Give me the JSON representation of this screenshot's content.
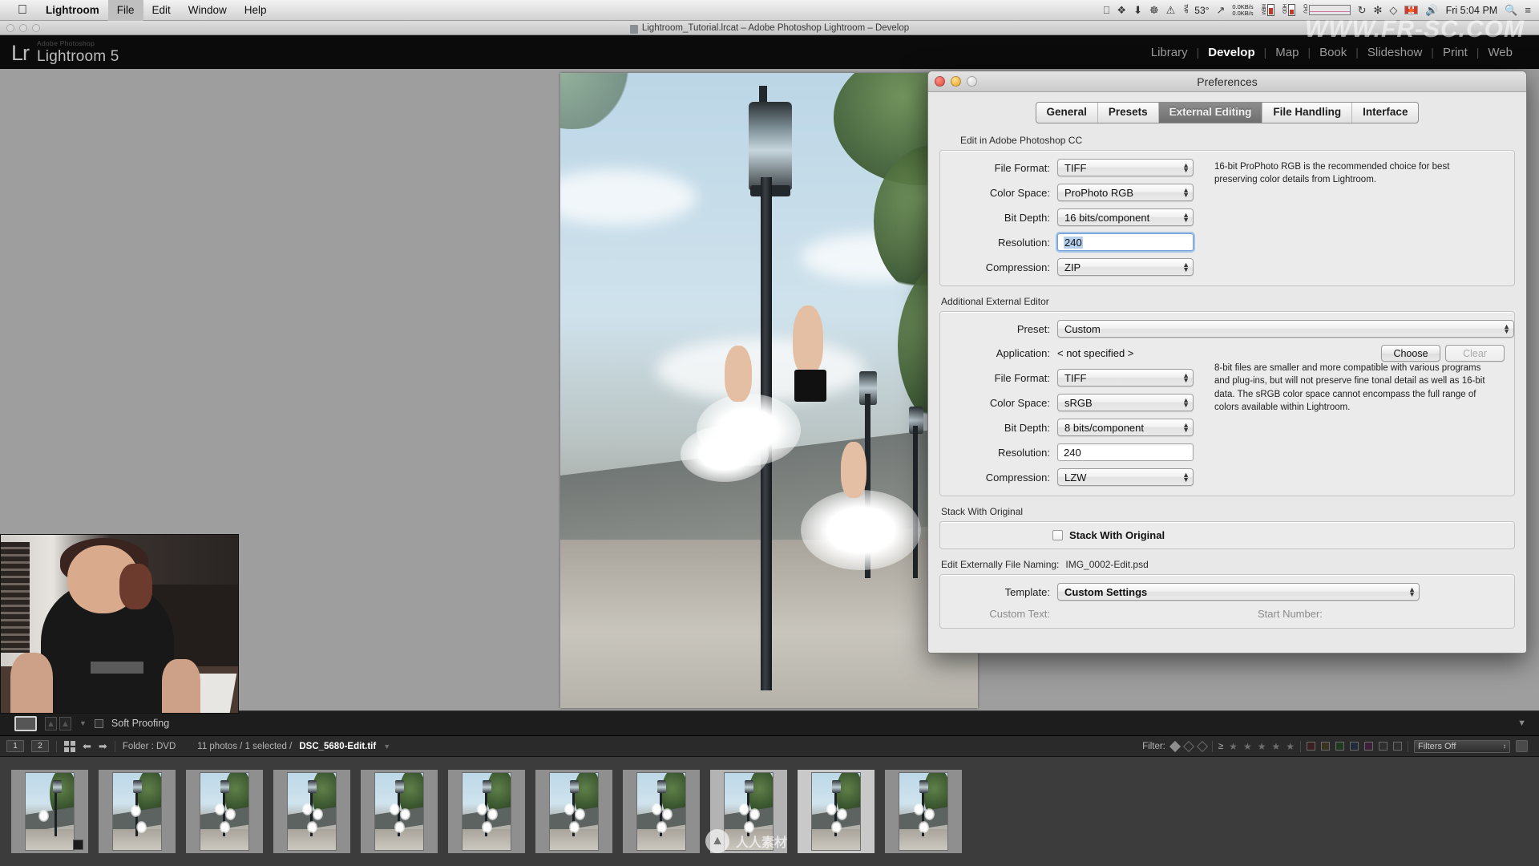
{
  "macmenu": {
    "apple_icon": "apple-icon",
    "items": [
      {
        "label": "Lightroom",
        "bold": true
      },
      {
        "label": "File",
        "bold": false
      },
      {
        "label": "Edit",
        "bold": false
      },
      {
        "label": "Window",
        "bold": false
      },
      {
        "label": "Help",
        "bold": false
      }
    ],
    "status": {
      "temperature": "53°",
      "net_up": "0.0KB/s",
      "net_down": "0.0KB/s",
      "mem_label": "MEM",
      "hdd_label": "HDD",
      "cpu_label": "CPU",
      "clock": "Fri 5:04 PM",
      "search_icon": "search-icon",
      "list_icon": "notification-center-icon",
      "speaker_icon": "volume-icon",
      "wifi_icon": "wifi-icon",
      "flag_icon": "canada-flag-icon",
      "bluetooth_icon": "bluetooth-icon",
      "timemachine_icon": "time-machine-icon",
      "battery_icon": "battery-warning-icon"
    }
  },
  "window": {
    "title": "Lightroom_Tutorial.lrcat – Adobe Photoshop Lightroom – Develop"
  },
  "lightroom": {
    "logo_mark": "Lr",
    "brand_small": "Adobe Photoshop",
    "brand_name": "Lightroom 5",
    "modules": [
      {
        "label": "Library",
        "active": false
      },
      {
        "label": "Develop",
        "active": true
      },
      {
        "label": "Map",
        "active": false
      },
      {
        "label": "Book",
        "active": false
      },
      {
        "label": "Slideshow",
        "active": false
      },
      {
        "label": "Print",
        "active": false
      },
      {
        "label": "Web",
        "active": false
      }
    ]
  },
  "toolbar": {
    "view_icon": "loupe-view-icon",
    "flag_icon_1": "flag-pick-icon",
    "flag_icon_2": "flag-reject-icon",
    "caret_icon": "chevron-down-icon",
    "soft_proofing_label": "Soft Proofing",
    "soft_proofing_checked": false,
    "collapse_icon": "chevron-down-icon"
  },
  "filmstrip_header": {
    "page_buttons": [
      "1",
      "2"
    ],
    "grid_icon": "grid-view-icon",
    "back_icon": "arrow-left-icon",
    "forward_icon": "arrow-right-icon",
    "source_label": "Folder : DVD",
    "count_label": "11 photos / 1 selected /",
    "selected_file": "DSC_5680-Edit.tif",
    "selected_caret": "chevron-down-icon",
    "filter_label": "Filter:",
    "rating_op": "≥",
    "filters_preset": "Filters Off",
    "lock_icon": "filter-lock-icon"
  },
  "filmstrip": {
    "thumbnails": [
      {
        "name": "thumb-1",
        "state": "normal",
        "badge": true
      },
      {
        "name": "thumb-2",
        "state": "normal",
        "badge": false
      },
      {
        "name": "thumb-3",
        "state": "normal",
        "badge": false
      },
      {
        "name": "thumb-4",
        "state": "normal",
        "badge": false
      },
      {
        "name": "thumb-5",
        "state": "normal",
        "badge": false
      },
      {
        "name": "thumb-6",
        "state": "normal",
        "badge": false
      },
      {
        "name": "thumb-7",
        "state": "normal",
        "badge": false
      },
      {
        "name": "thumb-8",
        "state": "normal",
        "badge": false
      },
      {
        "name": "thumb-9",
        "state": "active",
        "badge": false
      },
      {
        "name": "thumb-10",
        "state": "selected",
        "badge": false
      },
      {
        "name": "thumb-11",
        "state": "normal",
        "badge": false
      }
    ]
  },
  "preferences": {
    "title": "Preferences",
    "traffic_lights": [
      "close-button",
      "minimize-button",
      "zoom-button"
    ],
    "tabs": [
      {
        "label": "General",
        "active": false
      },
      {
        "label": "Presets",
        "active": false
      },
      {
        "label": "External Editing",
        "active": true
      },
      {
        "label": "File Handling",
        "active": false
      },
      {
        "label": "Interface",
        "active": false
      }
    ],
    "primary_editor": {
      "group_label": "Edit in Adobe Photoshop CC",
      "help_text": "16-bit ProPhoto RGB is the recommended choice for best preserving color details from Lightroom.",
      "fields": [
        {
          "label": "File Format:",
          "value": "TIFF",
          "type": "popup"
        },
        {
          "label": "Color Space:",
          "value": "ProPhoto RGB",
          "type": "popup"
        },
        {
          "label": "Bit Depth:",
          "value": "16 bits/component",
          "type": "popup"
        },
        {
          "label": "Resolution:",
          "value": "240",
          "type": "text",
          "focused": true
        },
        {
          "label": "Compression:",
          "value": "ZIP",
          "type": "popup"
        }
      ]
    },
    "additional_editor": {
      "group_label": "Additional External Editor",
      "preset_label": "Preset:",
      "preset_value": "Custom",
      "application_label": "Application:",
      "application_value": "< not specified >",
      "choose_button": "Choose",
      "clear_button": "Clear",
      "clear_disabled": true,
      "help_text": "8-bit files are smaller and more compatible with various programs and plug-ins, but will not preserve fine tonal detail as well as 16-bit data. The sRGB color space cannot encompass the full range of colors available within Lightroom.",
      "fields": [
        {
          "label": "File Format:",
          "value": "TIFF",
          "type": "popup"
        },
        {
          "label": "Color Space:",
          "value": "sRGB",
          "type": "popup"
        },
        {
          "label": "Bit Depth:",
          "value": "8 bits/component",
          "type": "popup"
        },
        {
          "label": "Resolution:",
          "value": "240",
          "type": "text",
          "focused": false
        },
        {
          "label": "Compression:",
          "value": "LZW",
          "type": "popup"
        }
      ]
    },
    "stack": {
      "group_label": "Stack With Original",
      "checkbox_label": "Stack With Original",
      "checked": false
    },
    "naming": {
      "group_label": "Edit Externally File Naming:",
      "sample": "IMG_0002-Edit.psd",
      "template_label": "Template:",
      "template_value": "Custom Settings",
      "custom_text_label": "Custom Text:",
      "start_number_label": "Start Number:"
    }
  },
  "watermarks": {
    "top_right": "WWW.FR-SC.COM",
    "center_text": "人人素材"
  },
  "colors": {
    "lr_background": "#0b0b0b",
    "canvas_gray": "#9e9e9e",
    "dialog_gray": "#e8e8e8",
    "focus_blue": "#6f9fd8",
    "selection_blue": "#b4d0ec",
    "active_tab": "#7a7a7a",
    "filmstrip_gray": "#3c3c3c"
  }
}
